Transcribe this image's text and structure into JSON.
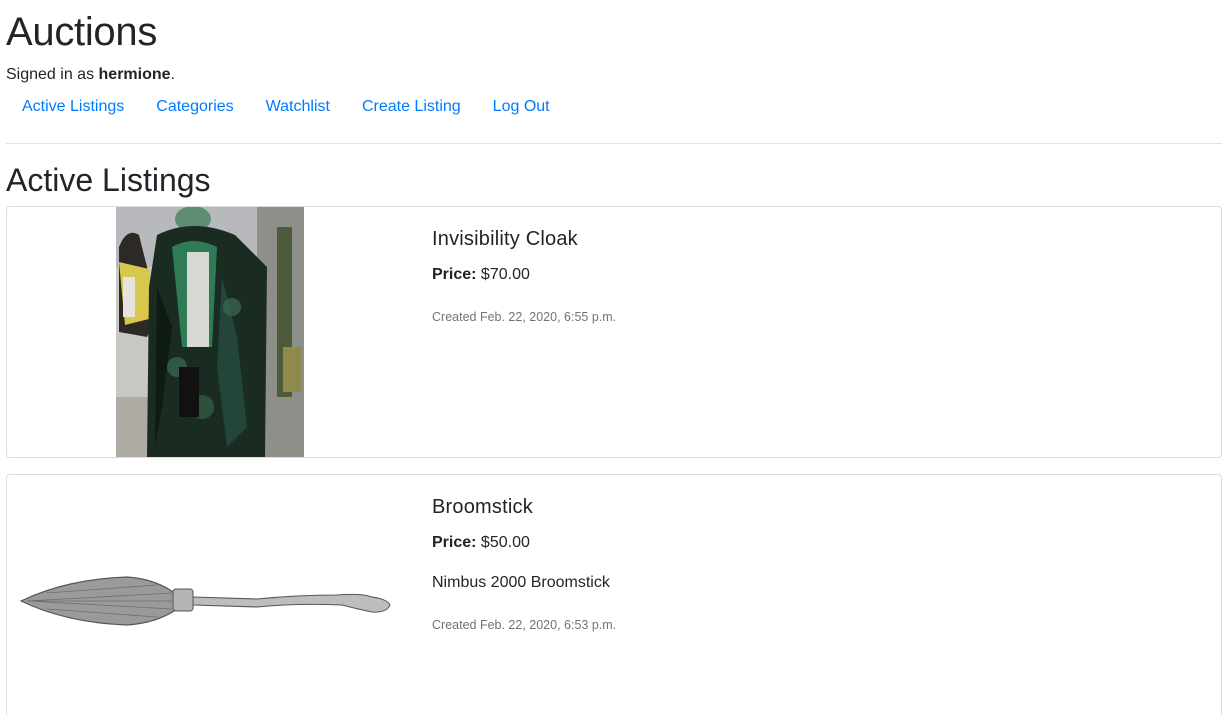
{
  "header": {
    "title": "Auctions",
    "signed_in_prefix": "Signed in as ",
    "username": "hermione",
    "signed_in_suffix": "."
  },
  "nav": {
    "items": [
      {
        "label": "Active Listings"
      },
      {
        "label": "Categories"
      },
      {
        "label": "Watchlist"
      },
      {
        "label": "Create Listing"
      },
      {
        "label": "Log Out"
      }
    ]
  },
  "colors": {
    "link": "#007bff",
    "muted_text": "#6c757d",
    "border": "#dcdcdc"
  },
  "main": {
    "section_title": "Active Listings",
    "listings": [
      {
        "title": "Invisibility Cloak",
        "price_label": "Price:",
        "price": "$70.00",
        "description": "",
        "created": "Created Feb. 22, 2020, 6:55 p.m.",
        "image": "cloak-photo"
      },
      {
        "title": "Broomstick",
        "price_label": "Price:",
        "price": "$50.00",
        "description": "Nimbus 2000 Broomstick",
        "created": "Created Feb. 22, 2020, 6:53 p.m.",
        "image": "broomstick-drawing"
      }
    ]
  }
}
